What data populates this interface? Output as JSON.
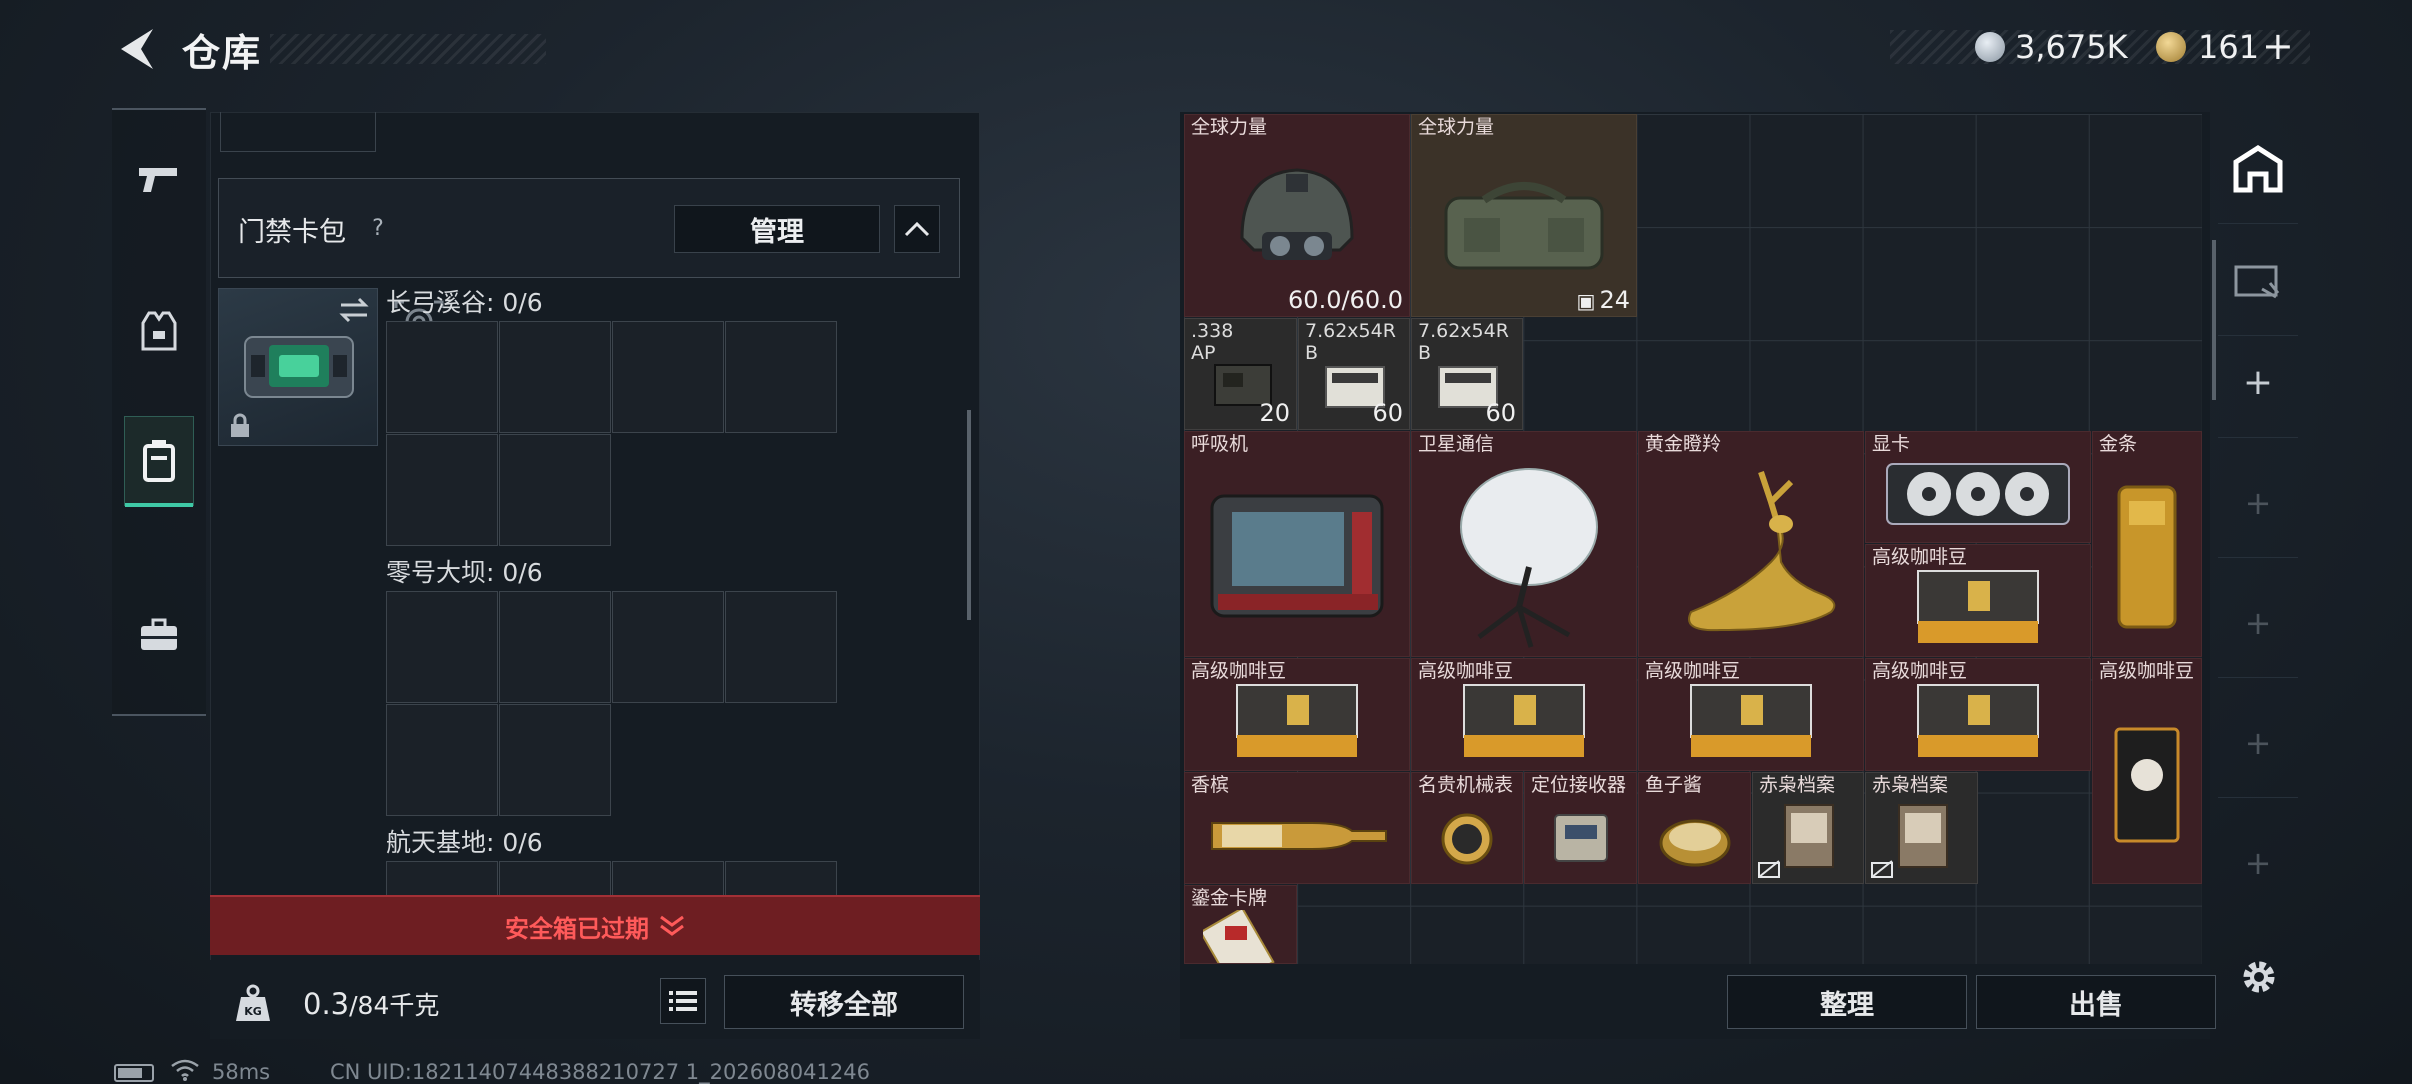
{
  "header": {
    "title": "仓库"
  },
  "currency": {
    "primary_value": "3,675K",
    "secondary_value": "161",
    "add_label": "+"
  },
  "left_panel": {
    "card_section_label": "门禁卡包",
    "help_label": "?",
    "manage_label": "管理",
    "sections": [
      {
        "name": "长弓溪谷: 0/6"
      },
      {
        "name": "零号大坝: 0/6"
      },
      {
        "name": "航天基地: 0/6"
      }
    ],
    "expired_label": "安全箱已过期",
    "weight_value": "0.3",
    "weight_capacity": "/84千克",
    "transfer_all_label": "转移全部"
  },
  "inventory": {
    "items": [
      {
        "name": "全球力量",
        "count": "60.0/60.0",
        "icon": "helmet-icon"
      },
      {
        "name": "全球力量",
        "count": "24",
        "icon": "backpack-icon"
      },
      {
        "name": ".338 AP",
        "count": "20",
        "icon": "ammo-box-icon"
      },
      {
        "name": "7.62x54R B",
        "count": "60",
        "icon": "ammo-box-icon"
      },
      {
        "name": "7.62x54R B",
        "count": "60",
        "icon": "ammo-box-icon"
      },
      {
        "name": "呼吸机",
        "count": "",
        "icon": "ventilator-icon"
      },
      {
        "name": "卫星通信",
        "count": "",
        "icon": "satellite-dish-icon"
      },
      {
        "name": "黄金瞪羚",
        "count": "",
        "icon": "golden-gazelle-icon"
      },
      {
        "name": "显卡",
        "count": "",
        "icon": "graphics-card-icon"
      },
      {
        "name": "金条",
        "count": "",
        "icon": "gold-bar-icon"
      },
      {
        "name": "高级咖啡豆",
        "count": "",
        "icon": "coffee-bag-icon"
      },
      {
        "name": "高级咖啡豆",
        "count": "",
        "icon": "coffee-bag-icon"
      },
      {
        "name": "高级咖啡豆",
        "count": "",
        "icon": "coffee-bag-icon"
      },
      {
        "name": "高级咖啡豆",
        "count": "",
        "icon": "coffee-bag-icon"
      },
      {
        "name": "高级咖啡豆",
        "count": "",
        "icon": "coffee-bag-icon"
      },
      {
        "name": "高级咖啡豆",
        "count": "",
        "icon": "coffee-bag-icon"
      },
      {
        "name": "香槟",
        "count": "",
        "icon": "champagne-icon"
      },
      {
        "name": "名贵机械表",
        "count": "",
        "icon": "watch-icon"
      },
      {
        "name": "定位接收器",
        "count": "",
        "icon": "receiver-icon"
      },
      {
        "name": "鱼子酱",
        "count": "",
        "icon": "caviar-icon"
      },
      {
        "name": "赤枭档案",
        "count": "",
        "icon": "dossier-icon"
      },
      {
        "name": "赤枭档案",
        "count": "",
        "icon": "dossier-icon"
      },
      {
        "name": "鎏金卡牌",
        "count": "",
        "icon": "gilded-card-icon"
      }
    ],
    "sort_label": "整理",
    "sell_label": "出售"
  },
  "status": {
    "ping": "58ms",
    "uid": "CN UID:18211407448388210727 1_202608041246"
  },
  "colors": {
    "accent": "#3fc9a6",
    "expired": "#ff5a5a",
    "item_red": "#3b1f24",
    "item_brown": "#3b3228"
  }
}
